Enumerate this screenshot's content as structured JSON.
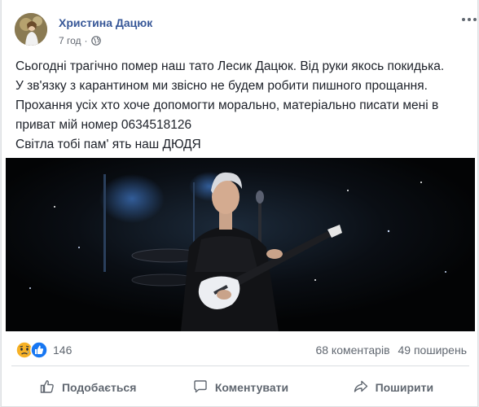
{
  "post": {
    "author": "Христина Дацюк",
    "time": "7 год",
    "separator": "·",
    "privacy_icon": "globe-icon",
    "more_icon": "more-options-icon",
    "text_lines": [
      "Сьогодні трагічно помер наш тато Лесик Дацюк. Від руки якось покидька.",
      "У зв'язку з карантином ми звісно не будем робити пишного прощання.",
      "Прохання усіх хто хоче допомогти морально, матеріально писати мені в",
      "приват мій номер 0634518126",
      "Світла тобі пам' ять наш ДЮДЯ"
    ]
  },
  "stats": {
    "reaction_icons": [
      "sad-reaction-icon",
      "like-reaction-icon"
    ],
    "reaction_count": "146",
    "comments": "68 коментарів",
    "shares": "49 поширень"
  },
  "actions": {
    "like": {
      "label": "Подобається",
      "icon": "thumbs-up-icon"
    },
    "comment": {
      "label": "Коментувати",
      "icon": "comment-icon"
    },
    "share": {
      "label": "Поширити",
      "icon": "share-icon"
    }
  },
  "colors": {
    "author": "#385898",
    "meta": "#616770",
    "text": "#1d2129",
    "like_blue": "#1877f2",
    "sad_yellow": "#f7b125"
  }
}
